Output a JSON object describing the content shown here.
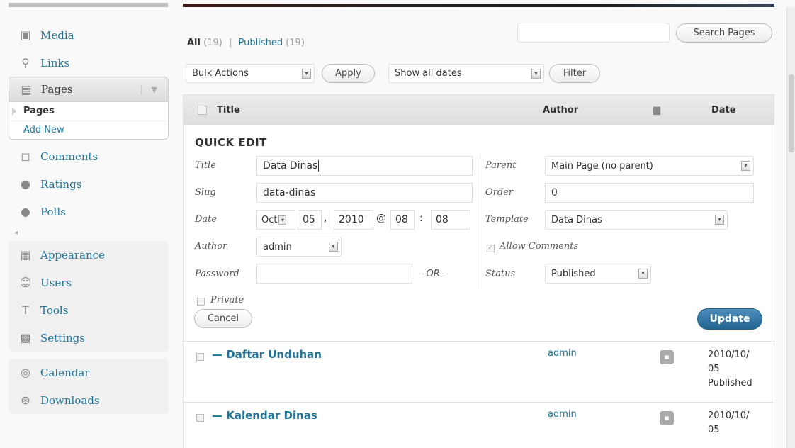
{
  "sidebar": {
    "items_top": [
      {
        "label": "Media",
        "icon": "media-icon"
      },
      {
        "label": "Links",
        "icon": "links-icon"
      }
    ],
    "pages": {
      "label": "Pages",
      "icon": "pages-icon"
    },
    "submenu": {
      "current": "Pages",
      "add_new": "Add New"
    },
    "items_mid": [
      {
        "label": "Comments",
        "icon": "comments-icon"
      },
      {
        "label": "Ratings",
        "icon": "ratings-icon"
      },
      {
        "label": "Polls",
        "icon": "polls-icon"
      }
    ],
    "items_bottom": [
      {
        "label": "Appearance",
        "icon": "appearance-icon"
      },
      {
        "label": "Users",
        "icon": "users-icon"
      },
      {
        "label": "Tools",
        "icon": "tools-icon"
      },
      {
        "label": "Settings",
        "icon": "settings-icon"
      }
    ],
    "items_plugins": [
      {
        "label": "Calendar",
        "icon": "calendar-icon"
      },
      {
        "label": "Downloads",
        "icon": "downloads-icon"
      }
    ]
  },
  "filters": {
    "all_label": "All",
    "all_count": "(19)",
    "sep": "|",
    "published_label": "Published",
    "published_count": "(19)"
  },
  "search": {
    "value": "",
    "button": "Search Pages"
  },
  "bulk": {
    "value": "Bulk Actions",
    "apply": "Apply"
  },
  "dates": {
    "value": "Show all dates",
    "filter": "Filter"
  },
  "table": {
    "headers": {
      "title": "Title",
      "author": "Author",
      "date": "Date"
    }
  },
  "quick_edit": {
    "heading": "QUICK EDIT",
    "title_label": "Title",
    "title_value": "Data Dinas",
    "slug_label": "Slug",
    "slug_value": "data-dinas",
    "date_label": "Date",
    "month": "Oct",
    "day": "05",
    "year": "2010",
    "hour": "08",
    "minute": "08",
    "comma": ",",
    "at": "@",
    "colon": ":",
    "author_label": "Author",
    "author_value": "admin",
    "password_label": "Password",
    "password_value": "",
    "or_label": "–OR–",
    "private_label": "Private",
    "parent_label": "Parent",
    "parent_value": "Main Page (no parent)",
    "order_label": "Order",
    "order_value": "0",
    "template_label": "Template",
    "template_value": "Data Dinas",
    "allow_comments_label": "Allow Comments",
    "status_label": "Status",
    "status_value": "Published",
    "cancel": "Cancel",
    "update": "Update"
  },
  "rows": [
    {
      "title": "— Daftar Unduhan",
      "author": "admin",
      "date1": "2010/10/",
      "date2": "05",
      "status": "Published"
    },
    {
      "title": "— Kalendar Dinas",
      "author": "admin",
      "date1": "2010/10/",
      "date2": "05",
      "status": ""
    }
  ],
  "colors": {
    "link": "#21759b",
    "update_button": "#21648f"
  }
}
